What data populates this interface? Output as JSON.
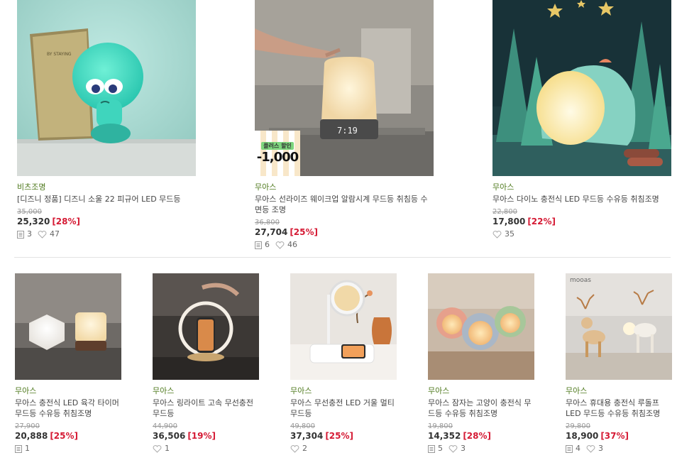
{
  "products_top": [
    {
      "brand": "비츠조명",
      "title": "[디즈니 정품] 디즈니 소울 22 피규어 LED 무드등",
      "original_price": "35,000",
      "price": "25,320",
      "discount": "[28%]",
      "reviews": "3",
      "likes": "47"
    },
    {
      "brand": "무아스",
      "title": "무아스 선라이즈 웨이크업 알람시계 무드등 취침등 수면등 조명",
      "original_price": "36,800",
      "price": "27,704",
      "discount": "[25%]",
      "reviews": "6",
      "likes": "46",
      "badge": {
        "top": "플러스 할인",
        "amount": "-1,000"
      }
    },
    {
      "brand": "무아스",
      "title": "무아스 다이노 충전식 LED 무드등 수유등 취침조명",
      "original_price": "22,800",
      "price": "17,800",
      "discount": "[22%]",
      "likes": "35"
    }
  ],
  "products_bottom": [
    {
      "brand": "무아스",
      "title": "무아스 충전식 LED 육각 타이머 무드등 수유등 취침조명",
      "original_price": "27,900",
      "price": "20,888",
      "discount": "[25%]",
      "reviews": "1"
    },
    {
      "brand": "무아스",
      "title": "무아스 링라이트 고속 무선충전 무드등",
      "original_price": "44,900",
      "price": "36,506",
      "discount": "[19%]",
      "likes": "1"
    },
    {
      "brand": "무아스",
      "title": "무아스 무선충전 LED 거울 멀티 무드등",
      "original_price": "49,800",
      "price": "37,304",
      "discount": "[25%]",
      "likes": "2"
    },
    {
      "brand": "무아스",
      "title": "무아스 잠자는 고양이 충전식 무드등 수유등 취침조명",
      "original_price": "19,800",
      "price": "14,352",
      "discount": "[28%]",
      "reviews": "5",
      "likes": "3"
    },
    {
      "brand": "무아스",
      "title": "무아스 휴대용 충전식 루돌프 LED 무드등 수유등 취침조명",
      "original_price": "29,800",
      "price": "18,900",
      "discount": "[37%]",
      "reviews": "4",
      "likes": "3",
      "image_logo": "mooas"
    }
  ],
  "colors": {
    "brand": "#4f7a1e",
    "discount": "#d51a34"
  },
  "icons": {
    "review": "review-list-icon",
    "like": "heart-outline-icon"
  }
}
